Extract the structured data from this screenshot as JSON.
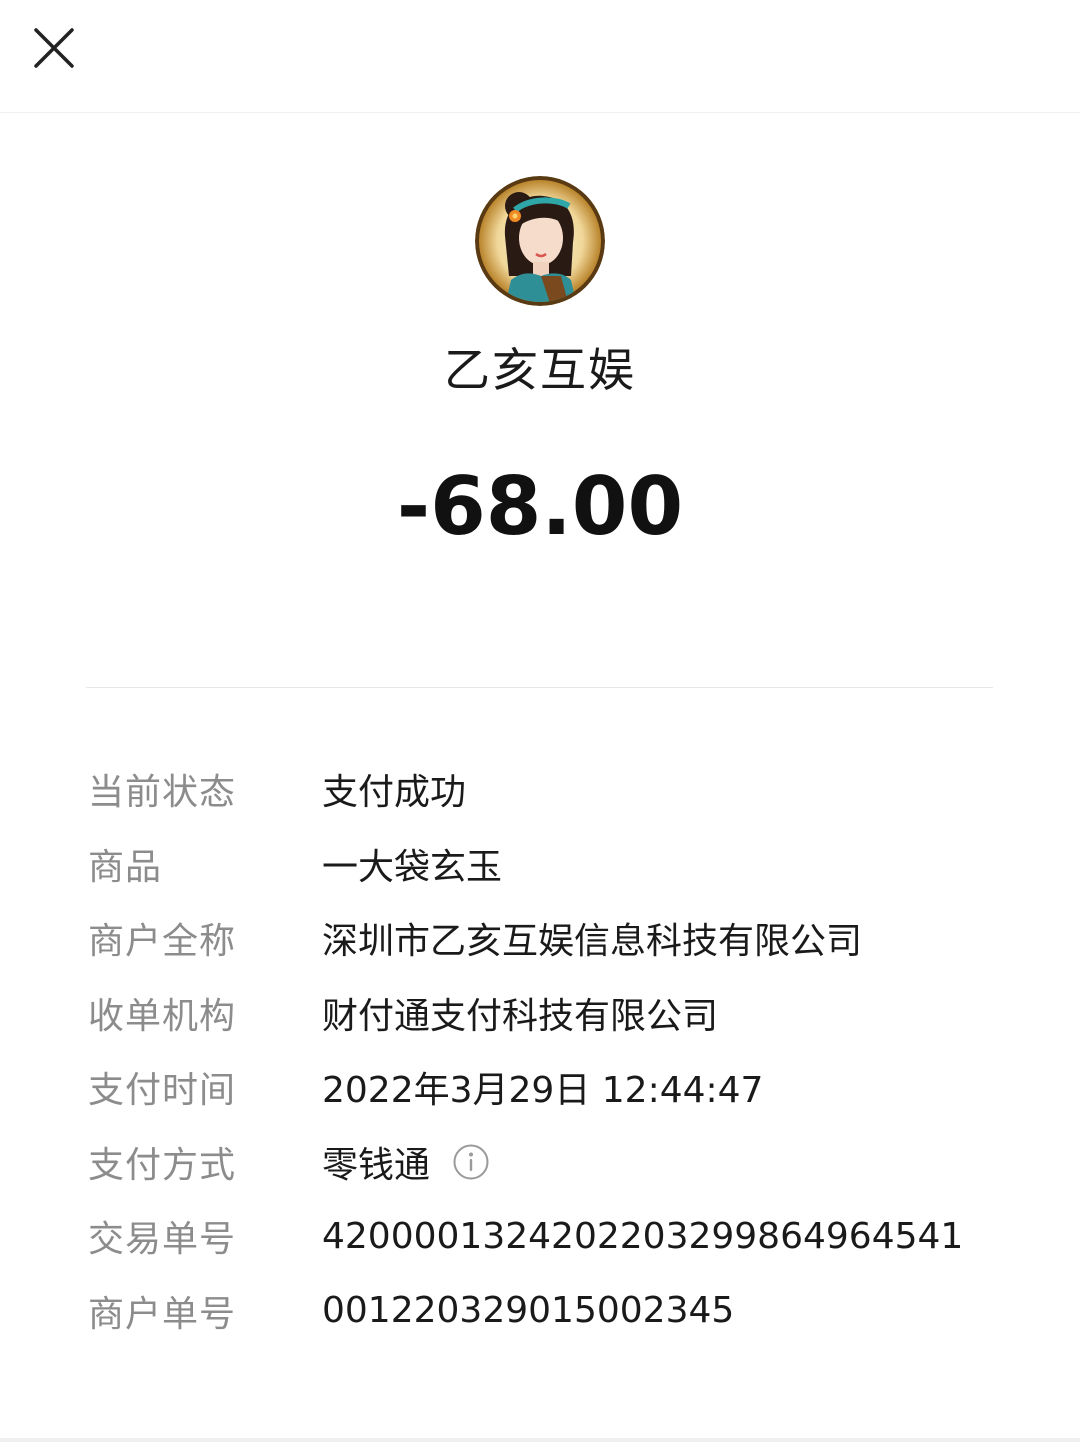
{
  "merchant": {
    "name": "乙亥互娱",
    "avatar_icon": "merchant-avatar-icon"
  },
  "amount": "-68.00",
  "details": [
    {
      "label": "当前状态",
      "value": "支付成功"
    },
    {
      "label": "商品",
      "value": "一大袋玄玉"
    },
    {
      "label": "商户全称",
      "value": "深圳市乙亥互娱信息科技有限公司"
    },
    {
      "label": "收单机构",
      "value": "财付通支付科技有限公司"
    },
    {
      "label": "支付时间",
      "value": "2022年3月29日 12:44:47"
    },
    {
      "label": "支付方式",
      "value": "零钱通"
    },
    {
      "label": "交易单号",
      "value": "4200001324202203299864964541"
    },
    {
      "label": "商户单号",
      "value": "001220329015002345"
    }
  ],
  "icons": {
    "close": "close-icon",
    "info": "info-icon"
  }
}
